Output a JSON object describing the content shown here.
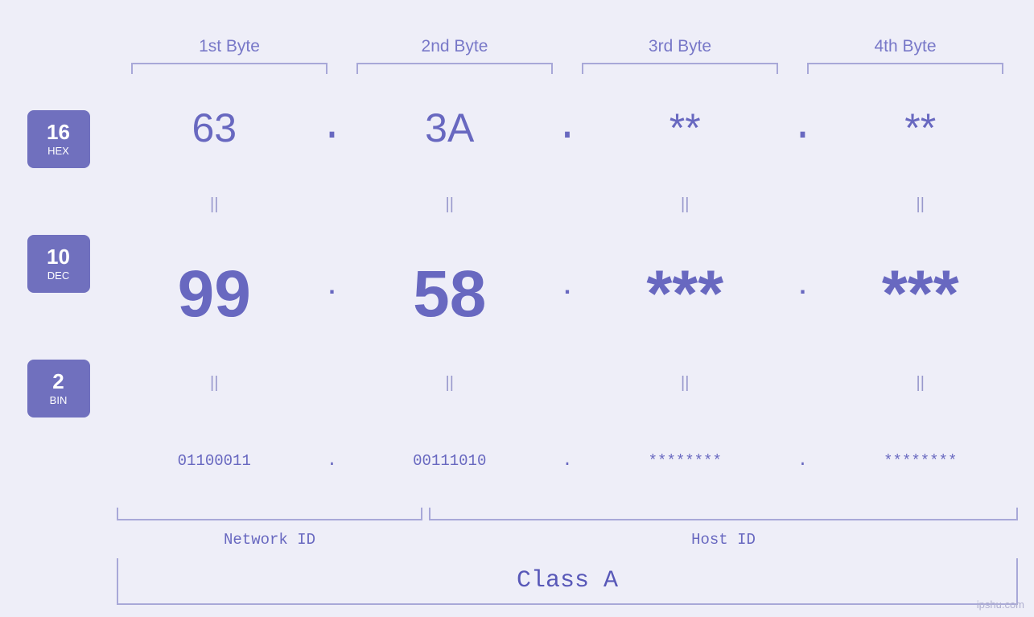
{
  "header": {
    "bytes": [
      "1st Byte",
      "2nd Byte",
      "3rd Byte",
      "4th Byte"
    ]
  },
  "bases": [
    {
      "number": "16",
      "label": "HEX"
    },
    {
      "number": "10",
      "label": "DEC"
    },
    {
      "number": "2",
      "label": "BIN"
    }
  ],
  "rows": {
    "hex": {
      "values": [
        "63",
        "3A",
        "**",
        "**"
      ],
      "dots": [
        ".",
        ".",
        ".",
        ""
      ]
    },
    "dec": {
      "values": [
        "99",
        "58",
        "***",
        "***"
      ],
      "dots": [
        ".",
        ".",
        ".",
        ""
      ]
    },
    "bin": {
      "values": [
        "01100011",
        "00111010",
        "********",
        "********"
      ],
      "dots": [
        ".",
        ".",
        ".",
        ""
      ]
    }
  },
  "equals": "||",
  "labels": {
    "network_id": "Network ID",
    "host_id": "Host ID",
    "class": "Class A"
  },
  "watermark": "ipshu.com"
}
